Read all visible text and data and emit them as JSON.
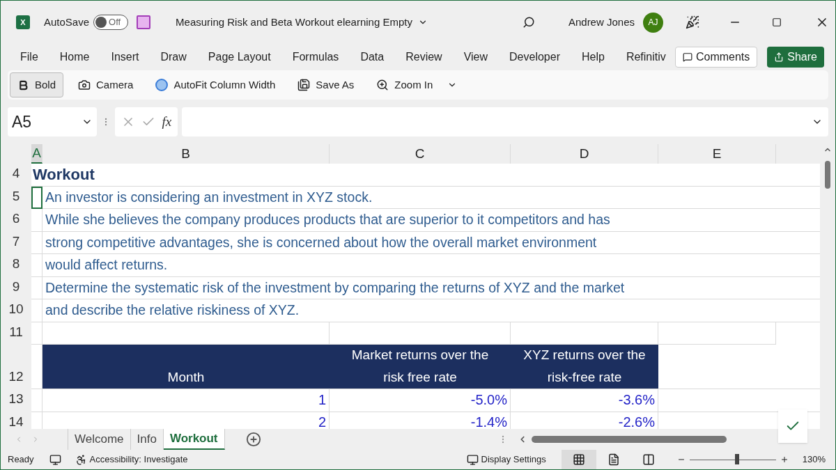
{
  "title_bar": {
    "app_logo": "X",
    "autosave_label": "AutoSave",
    "autosave": {
      "on": false,
      "label": "Off"
    },
    "document_title": "Measuring Risk and Beta Workout elearning Empty",
    "user_name": "Andrew Jones",
    "user_initials": "AJ"
  },
  "menu": [
    "File",
    "Home",
    "Insert",
    "Draw",
    "Page Layout",
    "Formulas",
    "Data",
    "Review",
    "View",
    "Developer",
    "Help",
    "Refinitiv"
  ],
  "comments_button": "Comments",
  "share_button": "Share",
  "quick_access": [
    {
      "label": "Bold",
      "kind": "bold",
      "selected": true
    },
    {
      "label": "Camera",
      "kind": "camera",
      "selected": false
    },
    {
      "label": "AutoFit Column Width",
      "kind": "autofit",
      "selected": false
    },
    {
      "label": "Save As",
      "kind": "saveas",
      "selected": false
    },
    {
      "label": "Zoom In",
      "kind": "zoomin",
      "selected": false
    }
  ],
  "formula_bar": {
    "name_box": "A5",
    "function_label": "fx"
  },
  "columns": [
    {
      "label": "A",
      "selected": true
    },
    {
      "label": "B",
      "selected": false
    },
    {
      "label": "C",
      "selected": false
    },
    {
      "label": "D",
      "selected": false
    },
    {
      "label": "E",
      "selected": false
    }
  ],
  "rows": [
    {
      "number": "4",
      "kind": "heading",
      "text": "Workout"
    },
    {
      "number": "5",
      "kind": "text",
      "text": "An investor is considering an investment in XYZ stock.",
      "selected": true
    },
    {
      "number": "6",
      "kind": "text",
      "text": "While she believes the company produces products that are superior to it competitors and has",
      "selected": false
    },
    {
      "number": "7",
      "kind": "text",
      "text": "strong competitive advantages, she is concerned about how the overall market environment",
      "selected": false
    },
    {
      "number": "8",
      "kind": "text",
      "text": "would affect returns.",
      "selected": false
    },
    {
      "number": "9",
      "kind": "text",
      "text": "Determine the systematic risk of the investment by comparing the returns of XYZ and the market",
      "selected": false
    },
    {
      "number": "10",
      "kind": "text",
      "text": "and describe the relative riskiness of XYZ.",
      "selected": false
    },
    {
      "number": "11",
      "kind": "blank"
    },
    {
      "number": "12",
      "kind": "table_header",
      "cells": [
        "Month",
        "Market returns over the risk free rate",
        "XYZ returns over the risk-free rate"
      ]
    },
    {
      "number": "13",
      "kind": "table_row",
      "cells": [
        "1",
        "-5.0%",
        "-3.6%"
      ]
    },
    {
      "number": "14",
      "kind": "table_row",
      "cells": [
        "2",
        "-1.4%",
        "-2.6%"
      ]
    }
  ],
  "sheet_tabs": [
    {
      "label": "Welcome",
      "selected": false
    },
    {
      "label": "Info",
      "selected": false
    },
    {
      "label": "Workout",
      "selected": true
    }
  ],
  "status_bar": {
    "status": "Ready",
    "accessibility": "Accessibility: Investigate",
    "display_settings": "Display Settings",
    "views": [
      {
        "kind": "normal",
        "selected": true
      },
      {
        "kind": "page_layout",
        "selected": false
      },
      {
        "kind": "page_break",
        "selected": false
      }
    ],
    "zoom": {
      "level": 0.55,
      "label": "130%"
    }
  }
}
